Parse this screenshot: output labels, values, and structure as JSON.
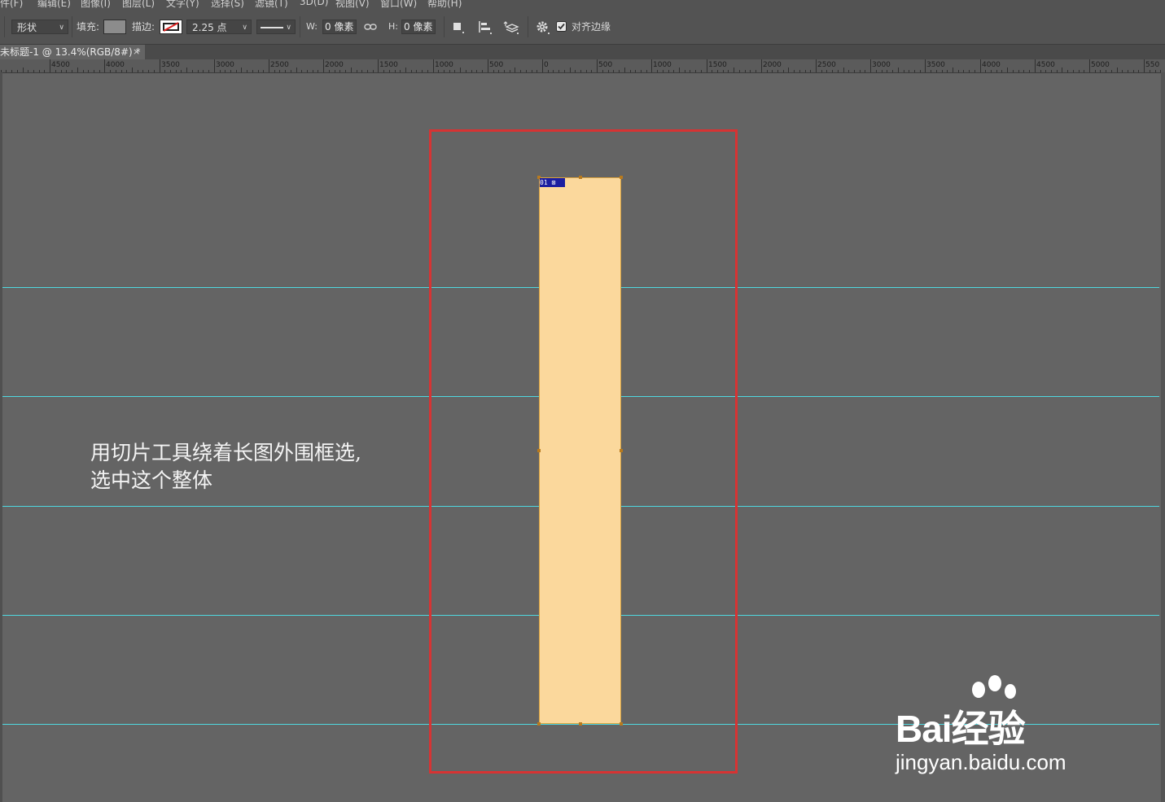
{
  "menubar": {
    "items": [
      "件(F)",
      "编辑(E)",
      "图像(I)",
      "图层(L)",
      "文字(Y)",
      "选择(S)",
      "滤镜(T)",
      "3D(D)",
      "视图(V)",
      "窗口(W)",
      "帮助(H)"
    ]
  },
  "options": {
    "mode_value": "形状",
    "fill_label": "填充:",
    "fill_color": "#8c8c8c",
    "stroke_label": "描边:",
    "stroke_width": "2.25 点",
    "w_label": "W:",
    "w_value": "0 像素",
    "h_label": "H:",
    "h_value": "0 像素",
    "align_edges_label": "对齐边缘",
    "align_edges_checked": true
  },
  "document": {
    "tab_title": "未标题-1 @ 13.4%(RGB/8#) *",
    "close_glyph": "×"
  },
  "ruler": {
    "labels": [
      "4500",
      "4000",
      "3500",
      "3000",
      "2500",
      "2000",
      "1500",
      "1000",
      "500",
      "0",
      "500",
      "1000",
      "1500",
      "2000",
      "2500",
      "3000",
      "3500",
      "4000",
      "4500",
      "5000",
      "550"
    ]
  },
  "canvas": {
    "artboard_color": "#fbd89c",
    "slice_badge": "01 ⊠",
    "selection_color": "#d73333",
    "guide_color": "#4fd8e0"
  },
  "annotation": {
    "line1": "用切片工具绕着长图外围框选,",
    "line2": "选中这个整体"
  },
  "watermark": {
    "brand": "Bai经验",
    "url": "jingyan.baidu.com"
  }
}
